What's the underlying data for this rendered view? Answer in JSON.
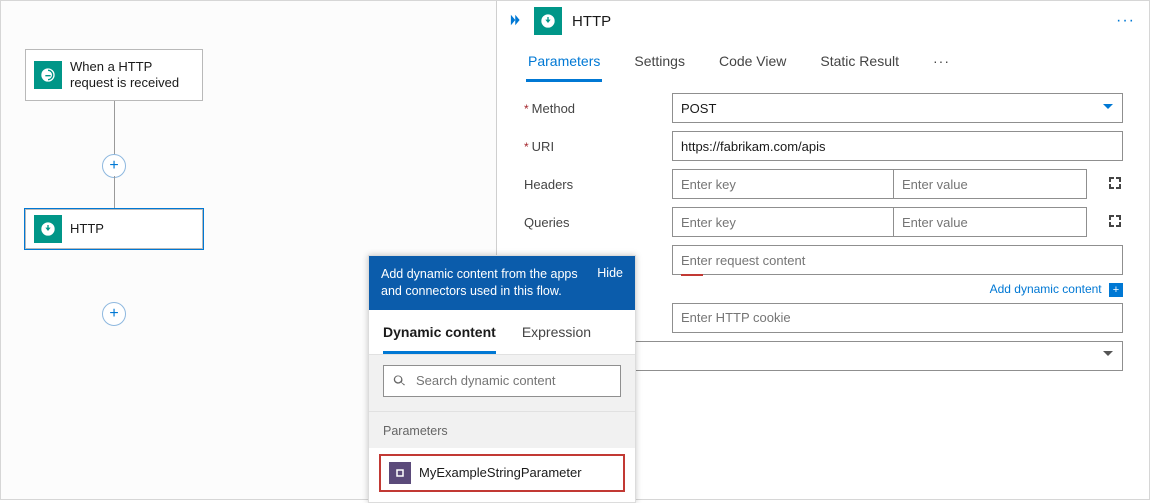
{
  "canvas": {
    "trigger": {
      "label": "When a HTTP request is received"
    },
    "http_node": {
      "label": "HTTP"
    }
  },
  "panel": {
    "title": "HTTP",
    "tabs": {
      "parameters": "Parameters",
      "settings": "Settings",
      "code_view": "Code View",
      "static_result": "Static Result"
    },
    "form": {
      "method": {
        "label": "Method",
        "value": "POST"
      },
      "uri": {
        "label": "URI",
        "value": "https://fabrikam.com/apis"
      },
      "headers": {
        "label": "Headers",
        "key_placeholder": "Enter key",
        "value_placeholder": "Enter value"
      },
      "queries": {
        "label": "Queries",
        "key_placeholder": "Enter key",
        "value_placeholder": "Enter value"
      },
      "body": {
        "placeholder": "Enter request content"
      },
      "cookie": {
        "placeholder": "Enter HTTP cookie"
      },
      "add_dynamic": "Add dynamic content"
    }
  },
  "popover": {
    "message": "Add dynamic content from the apps and connectors used in this flow.",
    "hide": "Hide",
    "tabs": {
      "dynamic": "Dynamic content",
      "expression": "Expression"
    },
    "search_placeholder": "Search dynamic content",
    "section_label": "Parameters",
    "item": "MyExampleStringParameter"
  }
}
